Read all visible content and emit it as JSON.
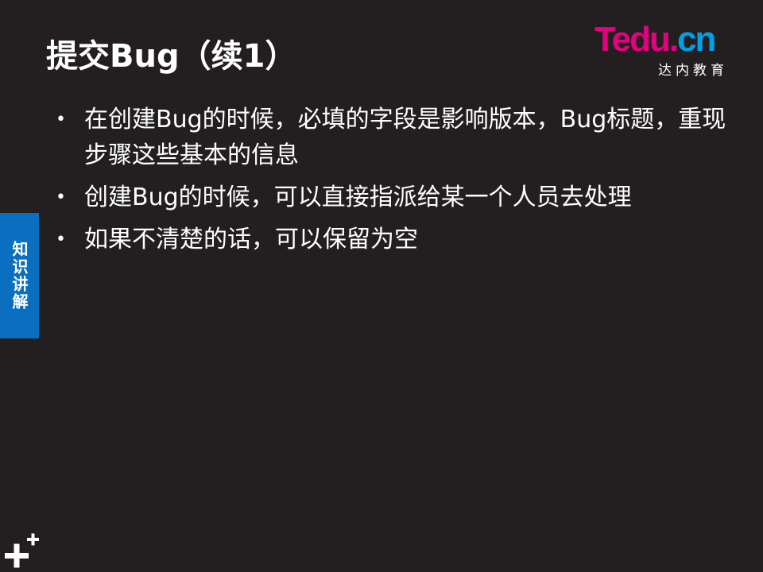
{
  "slide": {
    "title": "提交Bug（续1）",
    "logo": {
      "main_t": "T",
      "main_rest": "edu.",
      "main_cn": "cn",
      "sub": "达内教育"
    },
    "side_tab": "知识讲解",
    "bullet_symbol": "•",
    "bullets": [
      "在创建Bug的时候，必填的字段是影响版本，Bug标题，重现步骤这些基本的信息",
      "创建Bug的时候，可以直接指派给某一个人员去处理",
      "如果不清楚的话，可以保留为空"
    ],
    "colors": {
      "background": "#231f20",
      "side_tab": "#0a6fc0",
      "logo_pink": "#e4007f",
      "logo_blue": "#00a0e9"
    }
  }
}
